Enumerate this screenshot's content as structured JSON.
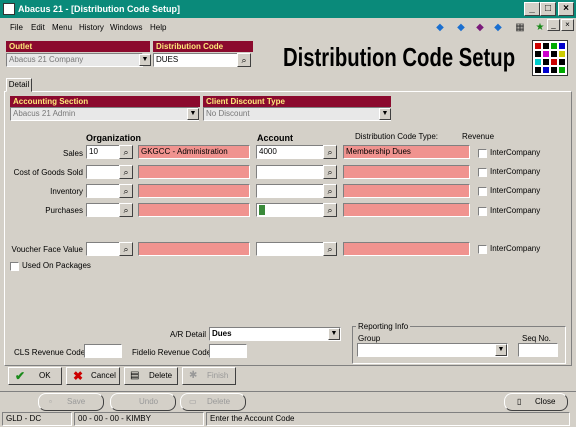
{
  "window": {
    "title": "Abacus 21 - [Distribution Code Setup]"
  },
  "menu": [
    "File",
    "Edit",
    "Menu",
    "History",
    "Windows",
    "Help"
  ],
  "outlet": {
    "label": "Outlet",
    "value": "Abacus 21 Company"
  },
  "distribution_code": {
    "label": "Distribution Code",
    "value": "DUES"
  },
  "page_title": "Distribution Code Setup",
  "tab": "Detail",
  "accounting_section": {
    "label": "Accounting Section",
    "value": "Abacus 21 Admin"
  },
  "client_discount": {
    "label": "Client Discount Type",
    "value": "No Discount"
  },
  "columns": {
    "organization": "Organization",
    "account": "Account",
    "dist_type_label": "Distribution Code Type:",
    "dist_type_value": "Revenue"
  },
  "rows": [
    {
      "label": "Sales",
      "org": "10",
      "org_name": "GKGCC - Administration",
      "account": "4000",
      "account_name": "Membership Dues",
      "interco": "InterCompany"
    },
    {
      "label": "Cost of Goods Sold",
      "org": "",
      "org_name": "",
      "account": "",
      "account_name": "",
      "interco": "InterCompany"
    },
    {
      "label": "Inventory",
      "org": "",
      "org_name": "",
      "account": "",
      "account_name": "",
      "interco": "InterCompany"
    },
    {
      "label": "Purchases",
      "org": "",
      "org_name": "",
      "account": "",
      "account_name": "",
      "interco": "InterCompany"
    },
    {
      "label": "Voucher Face Value",
      "org": "",
      "org_name": "",
      "account": "",
      "account_name": "",
      "interco": "InterCompany"
    }
  ],
  "used_on_packages": "Used On Packages",
  "ar_detail": {
    "label": "A/R Detail",
    "value": "Dues"
  },
  "cls_revenue": {
    "label": "CLS Revenue Code",
    "value": ""
  },
  "fidelio_revenue": {
    "label": "Fidelio Revenue Code",
    "value": ""
  },
  "reporting": {
    "title": "Reporting Info",
    "group_label": "Group",
    "seq_label": "Seq No.",
    "group_value": "",
    "seq_value": ""
  },
  "buttons": {
    "ok": "OK",
    "cancel": "Cancel",
    "delete": "Delete",
    "finish": "Finish"
  },
  "nav_buttons": {
    "save": "Save",
    "undo": "Undo",
    "delete": "Delete",
    "close": "Close"
  },
  "status": {
    "code": "GLD - DC",
    "session": "00 - 00 - 00 - KIMBY",
    "message": "Enter the Account Code"
  },
  "colors": {
    "title_bar": "#0a8a7a",
    "header_label_bg": "#8b0a2e",
    "header_label_text": "#ffe97a",
    "readonly_pink": "#f0938f"
  }
}
